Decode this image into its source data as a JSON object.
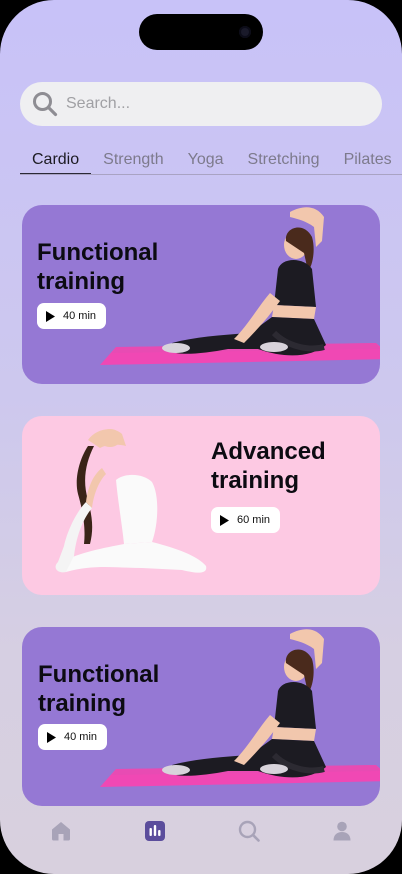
{
  "search": {
    "placeholder": "Search...",
    "value": ""
  },
  "categories": [
    {
      "label": "Cardio",
      "active": true
    },
    {
      "label": "Strength",
      "active": false
    },
    {
      "label": "Yoga",
      "active": false
    },
    {
      "label": "Stretching",
      "active": false
    },
    {
      "label": "Pilates",
      "active": false
    }
  ],
  "cards": [
    {
      "title": "Functional training",
      "duration": "40 min",
      "color": "#9578d4"
    },
    {
      "title": "Advanced training",
      "duration": "60 min",
      "color": "#fdc9e3"
    },
    {
      "title": "Functional training",
      "duration": "40 min",
      "color": "#9578d4"
    }
  ],
  "bottom_nav": [
    {
      "icon": "home-icon",
      "active": false
    },
    {
      "icon": "stats-icon",
      "active": true
    },
    {
      "icon": "search-icon",
      "active": false
    },
    {
      "icon": "profile-icon",
      "active": false
    }
  ],
  "colors": {
    "accent": "#5b4d9c",
    "inactive_icon": "#a8a3b8",
    "card_purple": "#9578d4",
    "card_pink": "#fdc9e3",
    "mat_pink": "#f048b4"
  }
}
